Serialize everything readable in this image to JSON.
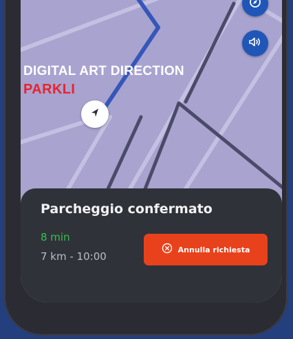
{
  "overlay": {
    "title": "DIGITAL ART DIRECTION",
    "subtitle": "PARKLI"
  },
  "map": {
    "controls": [
      {
        "icon": "compass-icon"
      },
      {
        "icon": "speaker-icon"
      }
    ],
    "marker_icon": "navigation-arrow-icon",
    "route_color": "#3457b9"
  },
  "sheet": {
    "title": "Parcheggio confermato",
    "eta_time": "8 min",
    "eta_detail": "7 km - 10:00",
    "cancel_button": {
      "label": "Annulla richiesta",
      "icon": "close-circle-icon",
      "color": "#e8421c"
    }
  },
  "colors": {
    "background": "#233f7d",
    "map": "#a8a3cf",
    "sheet": "#30323a",
    "accent_green": "#35c24a"
  }
}
